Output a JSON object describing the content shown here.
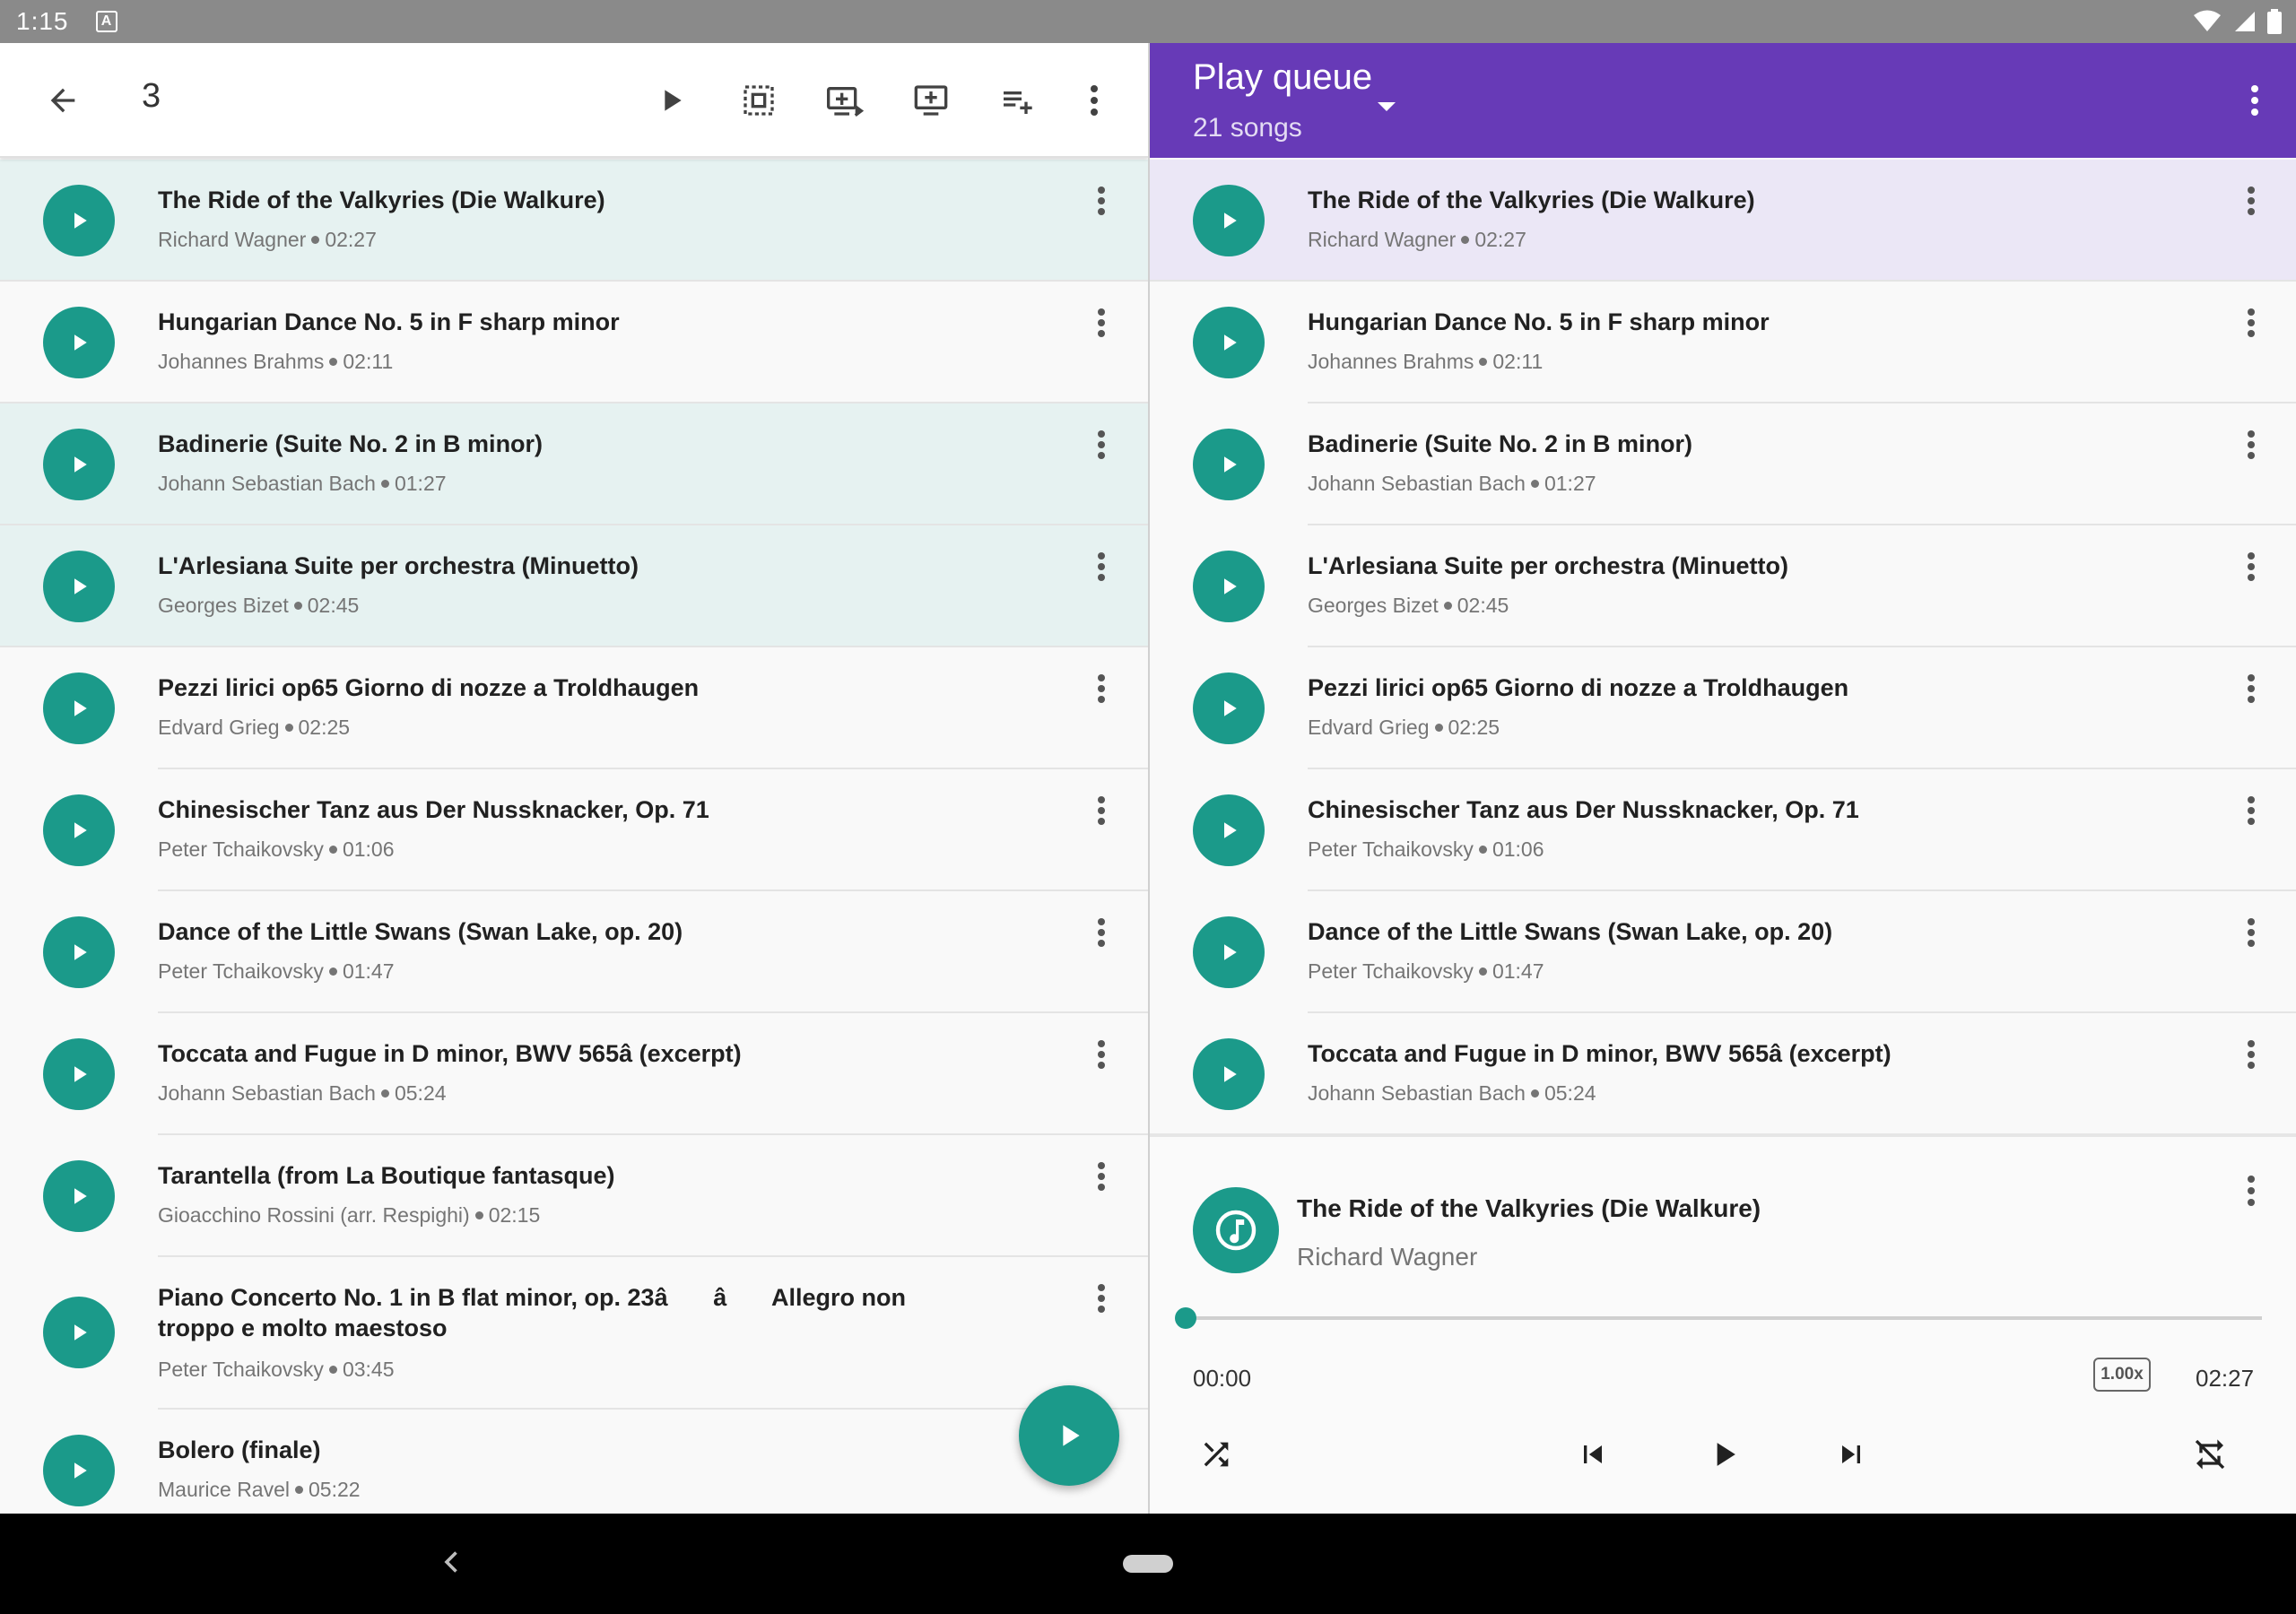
{
  "status_bar": {
    "time": "1:15",
    "notification_icon": "A"
  },
  "left": {
    "selection_count": "3",
    "toolbar_icons": [
      "back-arrow-icon",
      "play-icon",
      "select-all-icon",
      "queue-next-icon",
      "add-to-queue-icon",
      "add-to-playlist-icon",
      "more-vert-icon"
    ]
  },
  "queue": {
    "title": "Play queue",
    "subtitle": "21 songs"
  },
  "songs": [
    {
      "title": "The Ride of the Valkyries (Die Walkure)",
      "artist": "Richard Wagner",
      "duration": "02:27",
      "selected": true
    },
    {
      "title": "Hungarian Dance No. 5 in F sharp minor",
      "artist": "Johannes Brahms",
      "duration": "02:11",
      "selected": false
    },
    {
      "title": "Badinerie (Suite No. 2 in B minor)",
      "artist": "Johann Sebastian Bach",
      "duration": "01:27",
      "selected": true
    },
    {
      "title": "L'Arlesiana Suite per orchestra (Minuetto)",
      "artist": "Georges Bizet",
      "duration": "02:45",
      "selected": true
    },
    {
      "title": "Pezzi lirici op65 Giorno di nozze a Troldhaugen",
      "artist": "Edvard Grieg",
      "duration": "02:25",
      "selected": false
    },
    {
      "title": "Chinesischer Tanz aus Der Nussknacker, Op. 71",
      "artist": "Peter Tchaikovsky",
      "duration": "01:06",
      "selected": false
    },
    {
      "title": "Dance of the Little Swans (Swan Lake, op. 20)",
      "artist": "Peter Tchaikovsky",
      "duration": "01:47",
      "selected": false
    },
    {
      "title": "Toccata and Fugue in D minor, BWV 565â (excerpt)",
      "artist": "Johann Sebastian Bach",
      "duration": "05:24",
      "selected": false
    },
    {
      "title": "Tarantella (from La Boutique fantasque)",
      "artist": "Gioacchino Rossini (arr. Respighi)",
      "duration": "02:15",
      "selected": false
    },
    {
      "title": "Piano Concerto No. 1 in B flat minor, op. 23â â Allegro non troppo e molto maestoso",
      "artist": "Peter Tchaikovsky",
      "duration": "03:45",
      "selected": false
    },
    {
      "title": "Bolero (finale)",
      "artist": "Maurice Ravel",
      "duration": "05:22",
      "selected": false
    }
  ],
  "now_playing": {
    "title": "The Ride of the Valkyries (Die Walkure)",
    "artist": "Richard Wagner",
    "current_time": "00:00",
    "total_time": "02:27",
    "speed": "1.00x",
    "progress": 0.0
  },
  "colors": {
    "accent": "#1b9a8a",
    "queue_header": "#673ab7",
    "selected_row": "#e6f2f1",
    "current_row": "#ebe7f6"
  }
}
